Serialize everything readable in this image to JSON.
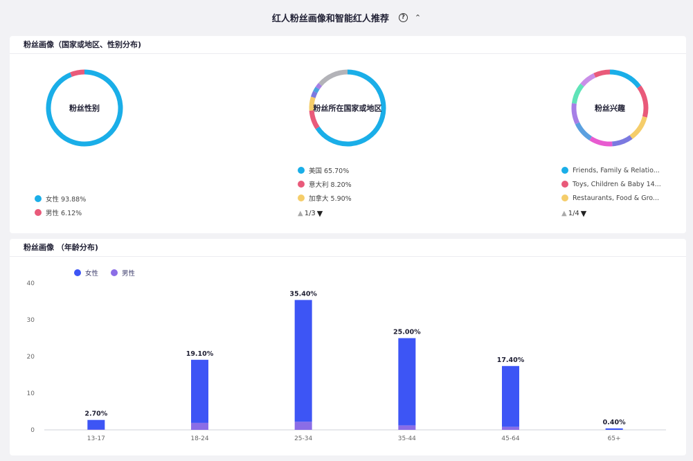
{
  "header": {
    "title": "红人粉丝画像和智能红人推荐",
    "help_icon": "question-circle-icon",
    "collapse_icon": "chevron-up-icon"
  },
  "colors": {
    "blue": "#1aaee8",
    "red": "#e95a7a",
    "yellow": "#f5cd6a",
    "grey": "#b3b3b8",
    "purple": "#7b79e0",
    "female_bar": "#3d55f5",
    "male_bar": "#8b6de6"
  },
  "portrait_card": {
    "title": "粉丝画像（国家或地区、性别分布)",
    "gender": {
      "center_label": "粉丝性别",
      "legend": [
        {
          "label": "女性 93.88%",
          "color": "#1aaee8"
        },
        {
          "label": "男性 6.12%",
          "color": "#e95a7a"
        }
      ],
      "slices": [
        {
          "value": 93.88,
          "color": "#1aaee8"
        },
        {
          "value": 6.12,
          "color": "#e95a7a"
        }
      ]
    },
    "country": {
      "center_label": "粉丝所在国家或地区",
      "legend": [
        {
          "label": "美国 65.70%",
          "color": "#1aaee8"
        },
        {
          "label": "意大利 8.20%",
          "color": "#e95a7a"
        },
        {
          "label": "加拿大 5.90%",
          "color": "#f5cd6a"
        }
      ],
      "pager": "1/3",
      "slices": [
        {
          "value": 65.7,
          "color": "#1aaee8"
        },
        {
          "value": 8.2,
          "color": "#e95a7a"
        },
        {
          "value": 5.9,
          "color": "#f5cd6a"
        },
        {
          "value": 2.5,
          "color": "#7b79e0"
        },
        {
          "value": 2.0,
          "color": "#4aa3de"
        },
        {
          "value": 2.0,
          "color": "#a67fe6"
        },
        {
          "value": 13.7,
          "color": "#b3b3b8"
        }
      ]
    },
    "interest": {
      "center_label": "粉丝兴趣",
      "legend": [
        {
          "label": "Friends, Family & Relatio...",
          "color": "#1aaee8"
        },
        {
          "label": "Toys, Children & Baby 14...",
          "color": "#e95a7a"
        },
        {
          "label": "Restaurants, Food & Gro...",
          "color": "#f5cd6a"
        }
      ],
      "pager": "1/4",
      "slices": [
        {
          "value": 15,
          "color": "#1aaee8"
        },
        {
          "value": 14,
          "color": "#e95a7a"
        },
        {
          "value": 11,
          "color": "#f5cd6a"
        },
        {
          "value": 9,
          "color": "#7b79e0"
        },
        {
          "value": 10,
          "color": "#e85bd0"
        },
        {
          "value": 9,
          "color": "#5aa0e0"
        },
        {
          "value": 9,
          "color": "#a67fe6"
        },
        {
          "value": 9,
          "color": "#5fe3b8"
        },
        {
          "value": 7,
          "color": "#c98ee8"
        },
        {
          "value": 7,
          "color": "#e95a7a"
        }
      ]
    }
  },
  "age_card": {
    "title": "粉丝画像 （年龄分布)",
    "legend": [
      {
        "label": "女性",
        "color": "#3d55f5"
      },
      {
        "label": "男性",
        "color": "#8b6de6"
      }
    ]
  },
  "chart_data": {
    "type": "bar",
    "categories": [
      "13-17",
      "18-24",
      "25-34",
      "35-44",
      "45-64",
      "65+"
    ],
    "series": [
      {
        "name": "女性",
        "values": [
          2.6,
          17.2,
          33.2,
          23.8,
          16.6,
          0.4
        ],
        "color": "#3d55f5"
      },
      {
        "name": "男性",
        "values": [
          0.1,
          1.9,
          2.2,
          1.2,
          0.8,
          0
        ],
        "color": "#8b6de6"
      }
    ],
    "data_labels": [
      "2.70%",
      "19.10%",
      "35.40%",
      "25.00%",
      "17.40%",
      "0.40%"
    ],
    "totals": [
      2.7,
      19.1,
      35.4,
      25.0,
      17.4,
      0.4
    ],
    "yticks": [
      0,
      10,
      20,
      30,
      40
    ],
    "ylim": [
      0,
      40
    ],
    "stacked": true,
    "legend_position": "top-left",
    "grid": false
  }
}
